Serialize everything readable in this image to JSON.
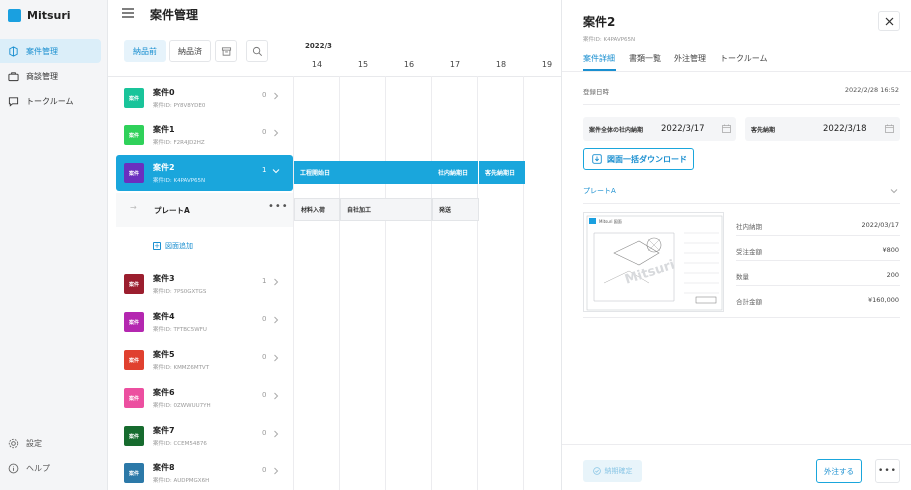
{
  "app": {
    "name": "Mitsuri",
    "brand_color": "#1aa0e0",
    "accent_color": "#1aa6dc"
  },
  "sidebar": {
    "items": [
      {
        "label": "案件管理",
        "icon": "project-icon",
        "active": true
      },
      {
        "label": "商談管理",
        "icon": "briefcase-icon",
        "active": false
      },
      {
        "label": "トークルーム",
        "icon": "chat-icon",
        "active": false
      }
    ],
    "bottom": [
      {
        "label": "設定",
        "icon": "gear-icon"
      },
      {
        "label": "ヘルプ",
        "icon": "info-icon"
      }
    ]
  },
  "header": {
    "title": "案件管理"
  },
  "filters": {
    "tabs": [
      {
        "label": "納品前",
        "active": true
      },
      {
        "label": "納品済",
        "active": false
      }
    ]
  },
  "timeline": {
    "month": "2022/3",
    "days": [
      "14",
      "15",
      "16",
      "17",
      "18",
      "19"
    ]
  },
  "projects": [
    {
      "badge": "案件",
      "title": "案件0",
      "id": "案件ID: PY8V8YDE0",
      "count": "0",
      "color": "#19c49a"
    },
    {
      "badge": "案件",
      "title": "案件1",
      "id": "案件ID: F2R4JD2HZ",
      "count": "0",
      "color": "#2fd15a"
    },
    {
      "badge": "案件",
      "title": "案件2",
      "id": "案件ID: K4PAVP65N",
      "count": "1",
      "color": "#6a2fbf"
    },
    {
      "badge": "案件",
      "title": "案件3",
      "id": "案件ID: 7PS0GXTGS",
      "count": "1",
      "color": "#9b1e2e"
    },
    {
      "badge": "案件",
      "title": "案件4",
      "id": "案件ID: TFTBC5WFU",
      "count": "0",
      "color": "#b427b0"
    },
    {
      "badge": "案件",
      "title": "案件5",
      "id": "案件ID: KMMZ6MTVT",
      "count": "0",
      "color": "#e0402f"
    },
    {
      "badge": "案件",
      "title": "案件6",
      "id": "案件ID: 0ZWWUU7YH",
      "count": "0",
      "color": "#ec4fa0"
    },
    {
      "badge": "案件",
      "title": "案件7",
      "id": "案件ID: CCEM54876",
      "count": "0",
      "color": "#166b2e"
    },
    {
      "badge": "案件",
      "title": "案件8",
      "id": "案件ID: AUDPMGX6H",
      "count": "0",
      "color": "#2c79a8"
    }
  ],
  "sub_item": {
    "label": "プレートA"
  },
  "add_drawing": "図面追加",
  "gantt": {
    "main_bars": [
      "工程開始日",
      "社内納期日",
      "客先納期日"
    ],
    "sub_bars": [
      "材料入荷",
      "自社加工",
      "発送"
    ]
  },
  "panel": {
    "title": "案件2",
    "id": "案件ID: K4PAVP65N",
    "tabs": [
      "案件詳細",
      "書類一覧",
      "外注管理",
      "トークルーム"
    ],
    "registered_label": "登録日時",
    "registered_value": "2022/2/28 16:52",
    "internal_deadline_label": "案件全体の社内納期",
    "internal_deadline_value": "2022/3/17",
    "client_deadline_label": "客先納期",
    "client_deadline_value": "2022/3/18",
    "download_label": "図面一括ダウンロード",
    "section_label": "プレートA",
    "thumb_header": "Mitsuri 図面",
    "watermark": "Mitsuri",
    "specs": [
      {
        "label": "社内納期",
        "value": "2022/03/17"
      },
      {
        "label": "受注金額",
        "value": "¥800"
      },
      {
        "label": "数量",
        "value": "200"
      },
      {
        "label": "合計金額",
        "value": "¥160,000"
      }
    ],
    "confirm_label": "納期確定",
    "order_label": "外注する",
    "more_label": "•••"
  }
}
